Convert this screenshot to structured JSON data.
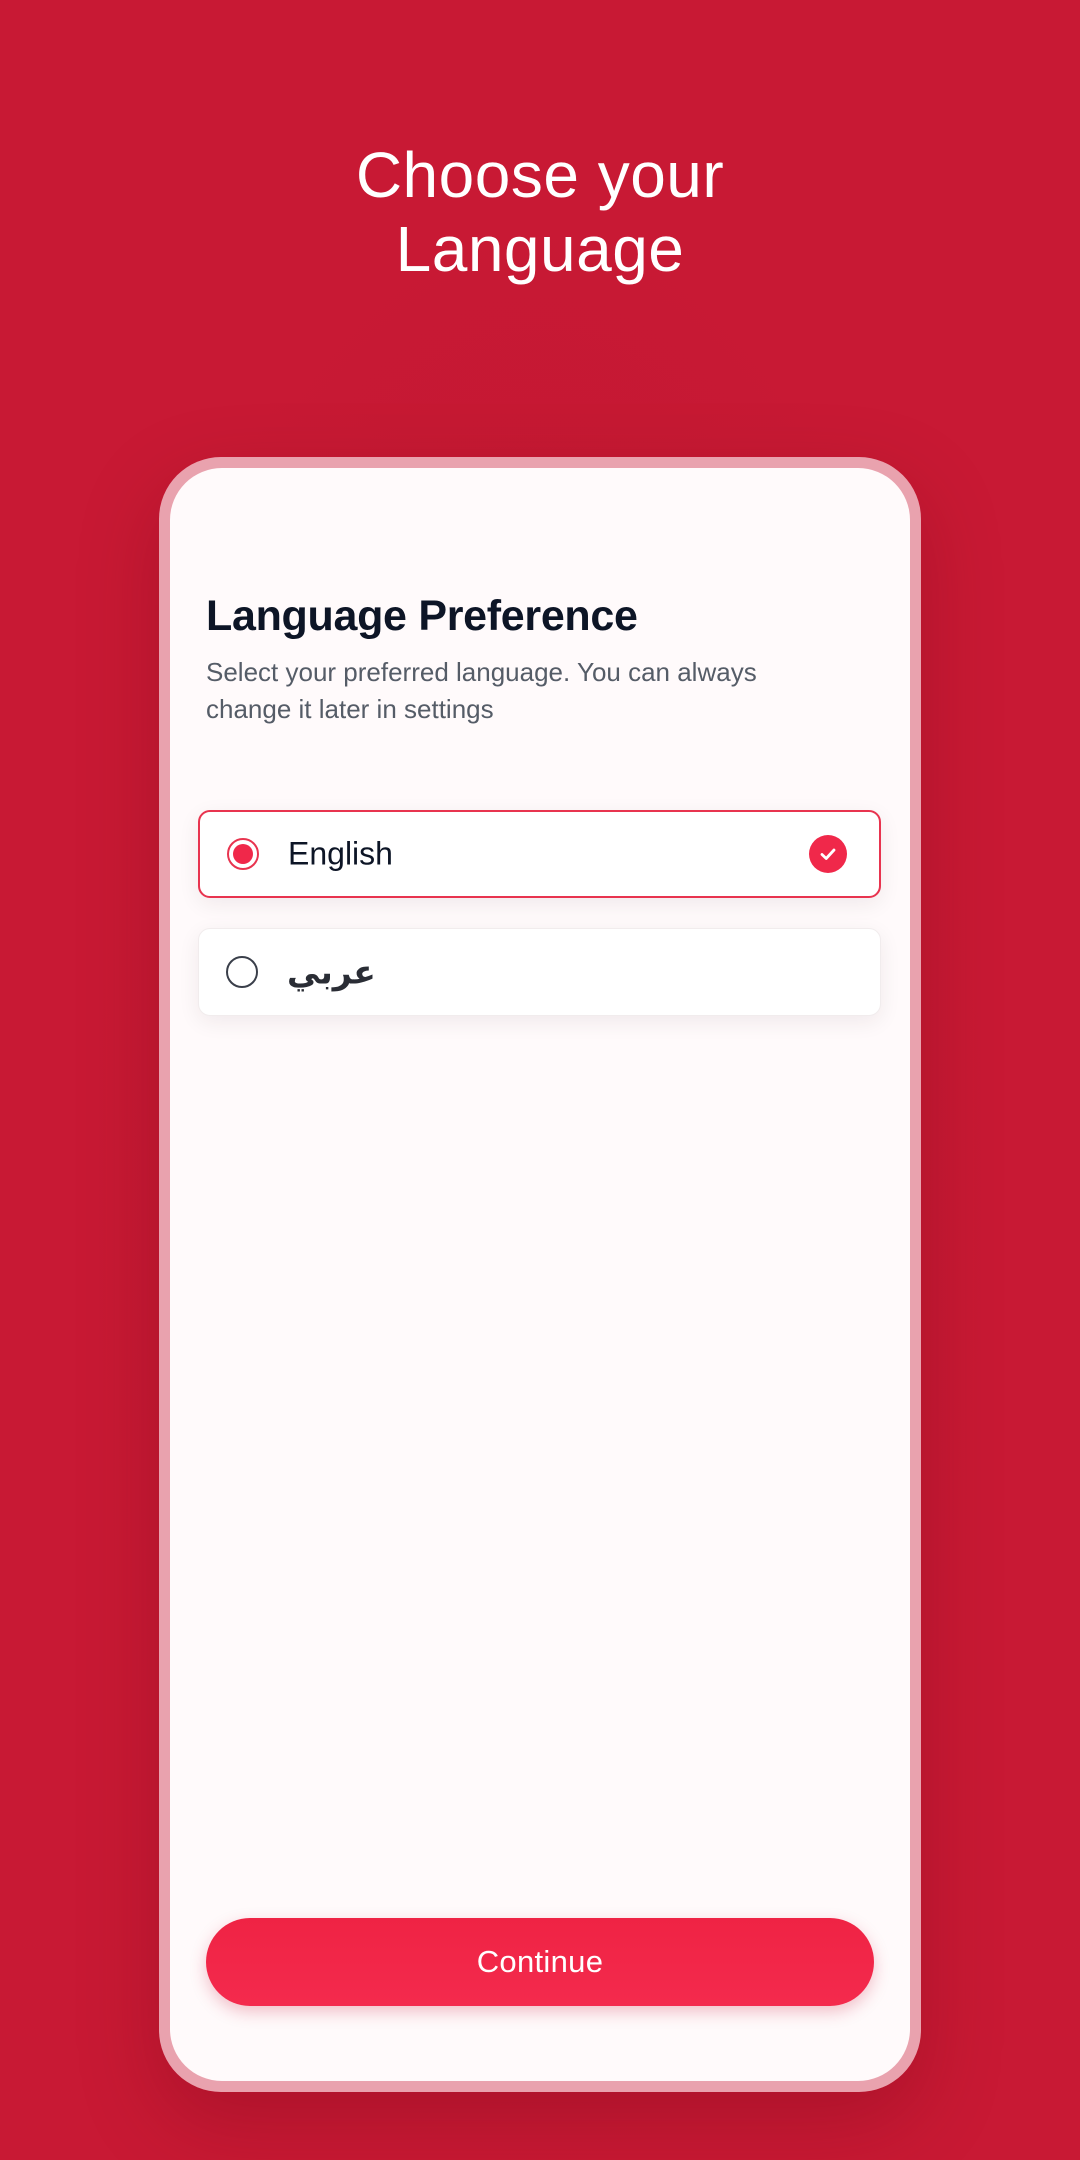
{
  "header": {
    "title_line1": "Choose your",
    "title_line2": "Language"
  },
  "card": {
    "title": "Language Preference",
    "subtitle": "Select your preferred language. You can always change it later in settings"
  },
  "options": [
    {
      "label": "English",
      "selected": true
    },
    {
      "label": "عربي",
      "selected": false
    }
  ],
  "continue_label": "Continue",
  "colors": {
    "background": "#c81934",
    "accent": "#f0284a",
    "frame": "#e9a2ae",
    "title_text": "#0d1526",
    "subtitle_text": "#555c67"
  },
  "icons": {
    "selected_check": "check-circle-icon"
  }
}
